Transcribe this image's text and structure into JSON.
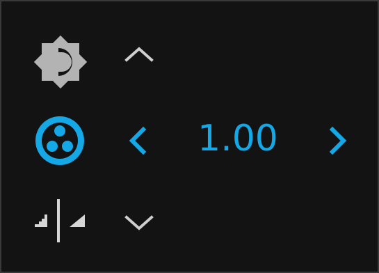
{
  "controls": {
    "brightness": {
      "icon": "brightness-icon",
      "color": "#b7b7b7"
    },
    "color_filter": {
      "icon": "color-filter-icon",
      "color": "#14a8e6",
      "active": true
    },
    "sharpness": {
      "icon": "sharpness-icon",
      "color": "#d6d6d6"
    }
  },
  "navigation": {
    "up": {
      "icon": "chevron-up-icon",
      "color": "#cfcfcf"
    },
    "down": {
      "icon": "chevron-down-icon",
      "color": "#cfcfcf"
    },
    "left": {
      "icon": "chevron-left-icon",
      "color": "#14a8e6"
    },
    "right": {
      "icon": "chevron-right-icon",
      "color": "#14a8e6"
    }
  },
  "value": {
    "display": "1.00"
  },
  "colors": {
    "background": "#131313",
    "accent": "#14a8e6",
    "inactive": "#b7b7b7"
  }
}
